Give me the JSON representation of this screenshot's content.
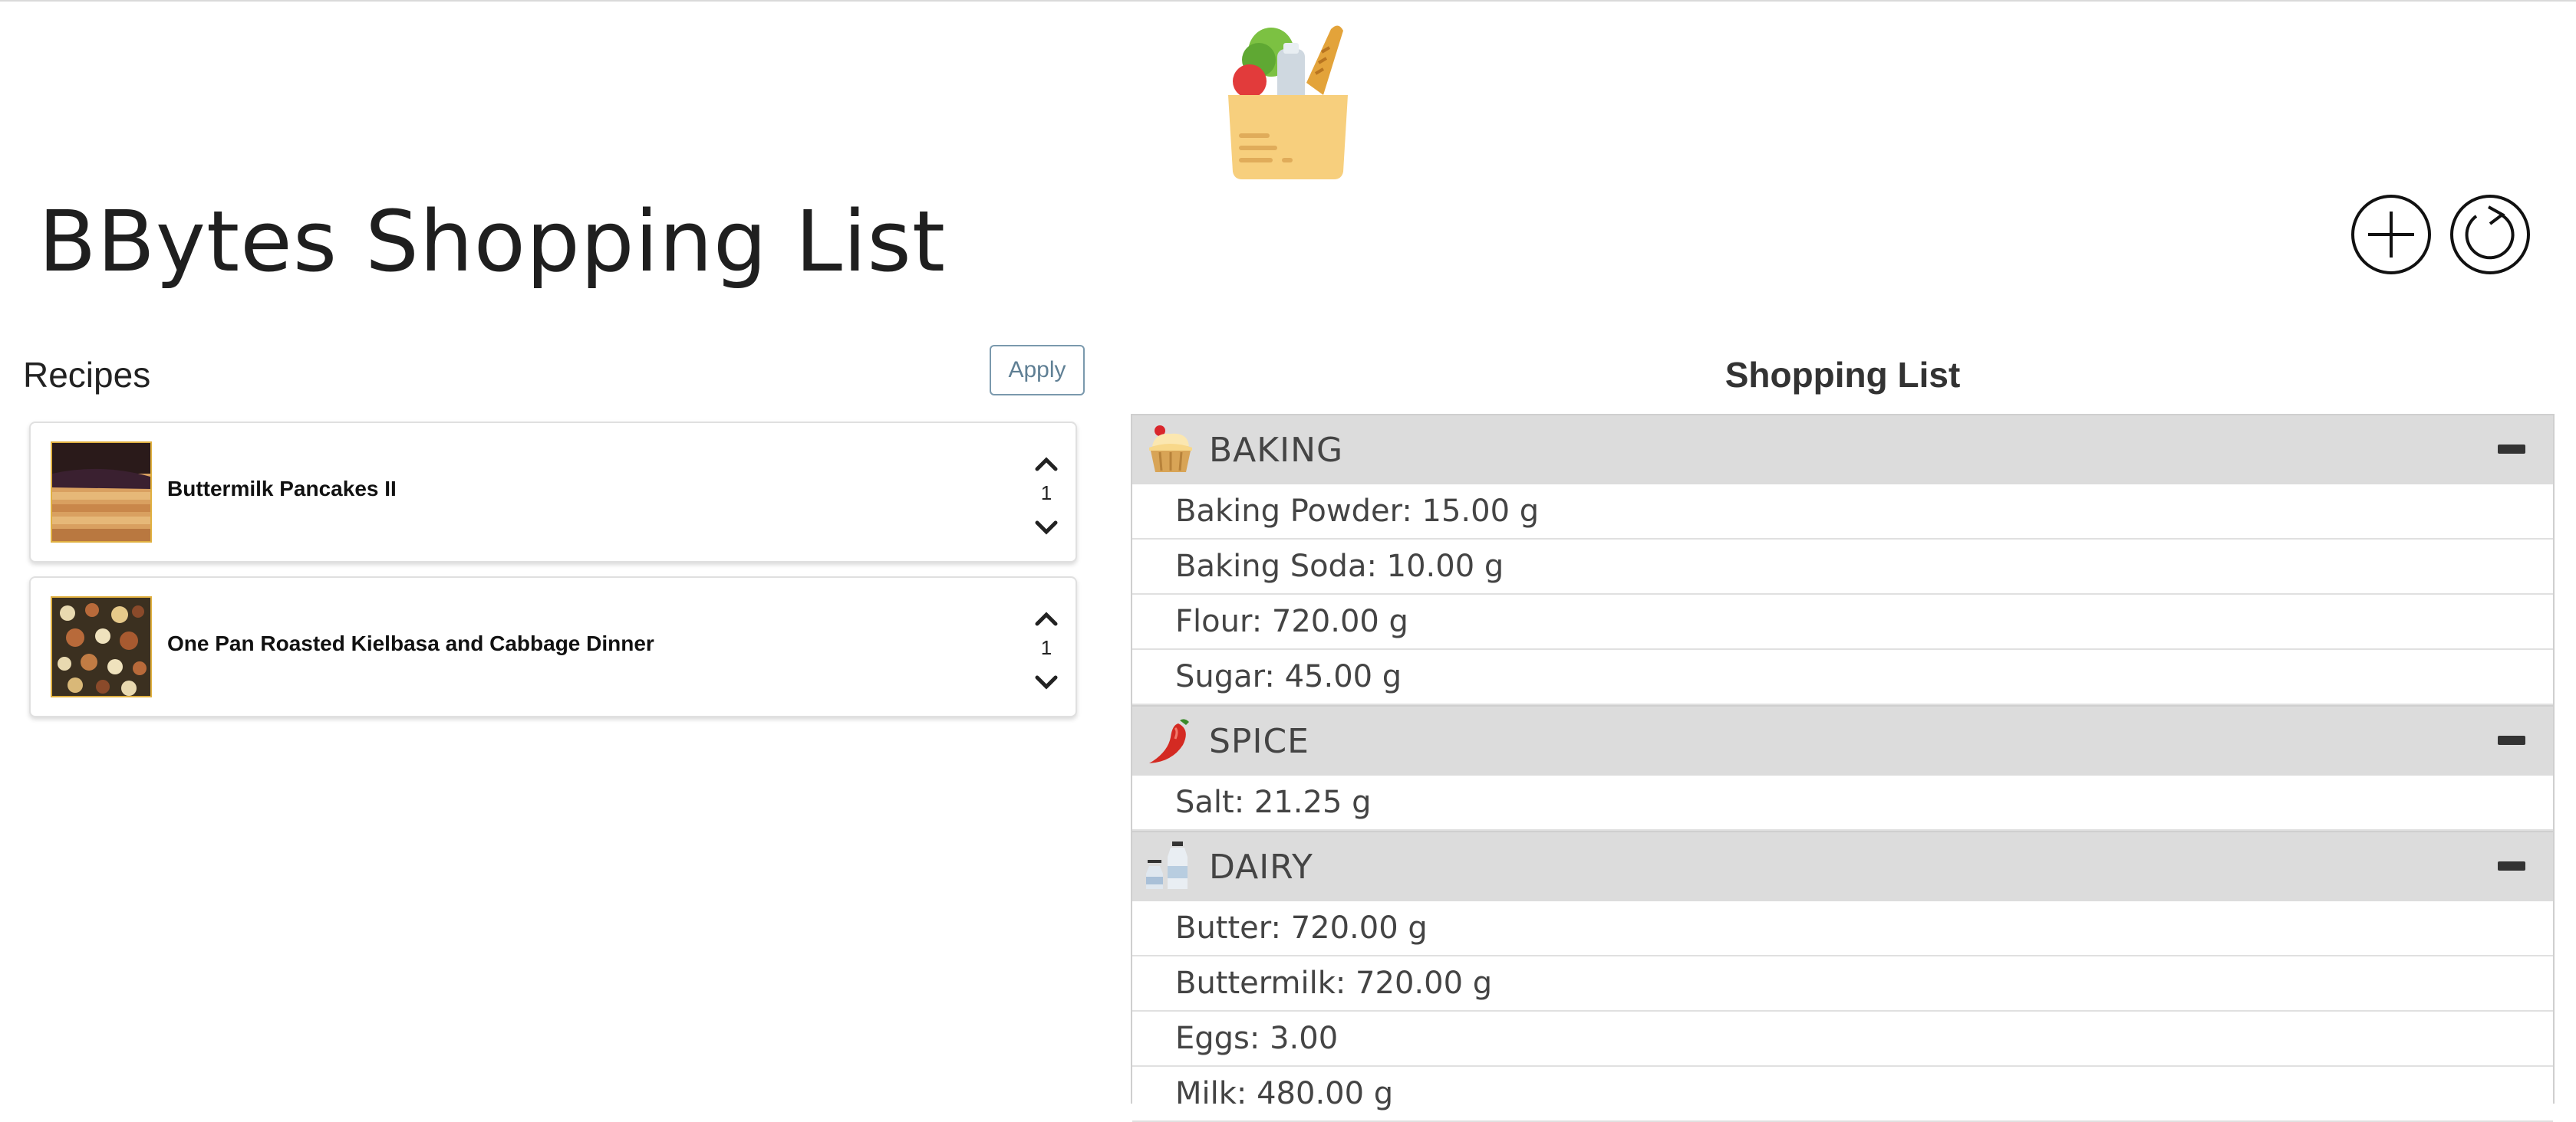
{
  "header": {
    "title": "BBytes Shopping List",
    "add_icon": "circle-plus-icon",
    "refresh_icon": "circle-refresh-icon",
    "logo_icon": "grocery-bag-icon"
  },
  "recipes": {
    "heading": "Recipes",
    "apply_label": "Apply",
    "items": [
      {
        "name": "Buttermilk Pancakes II",
        "quantity": "1"
      },
      {
        "name": "One Pan Roasted Kielbasa and Cabbage Dinner",
        "quantity": "1"
      }
    ]
  },
  "shopping_list": {
    "heading": "Shopping List",
    "categories": [
      {
        "name": "BAKING",
        "icon": "cupcake-icon",
        "items": [
          "Baking Powder: 15.00 g",
          "Baking Soda: 10.00 g",
          "Flour: 720.00 g",
          "Sugar: 45.00 g"
        ]
      },
      {
        "name": "SPICE",
        "icon": "chili-pepper-icon",
        "items": [
          "Salt: 21.25 g"
        ]
      },
      {
        "name": "DAIRY",
        "icon": "milk-bottles-icon",
        "items": [
          "Butter: 720.00 g",
          "Buttermilk: 720.00 g",
          "Eggs: 3.00",
          "Milk: 480.00 g"
        ]
      }
    ]
  },
  "colors": {
    "category_header_bg": "#dcdcdc",
    "apply_border": "#7a99ad"
  }
}
